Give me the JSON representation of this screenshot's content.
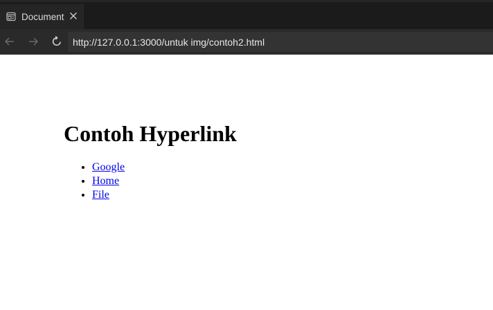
{
  "tab": {
    "title": "Document",
    "icon": "page-icon",
    "close_icon": "close-icon"
  },
  "navigation": {
    "back_icon": "arrow-left-icon",
    "forward_icon": "arrow-right-icon",
    "reload_icon": "reload-icon",
    "url": "http://127.0.0.1:3000/untuk img/contoh2.html"
  },
  "page": {
    "heading": "Contoh Hyperlink",
    "links": [
      {
        "label": "Google"
      },
      {
        "label": "Home"
      },
      {
        "label": "File"
      }
    ]
  },
  "colors": {
    "tab_bar": "#1b1b1b",
    "tab_active": "#252525",
    "nav_bar": "#2a2a2a",
    "address_bg": "#333333",
    "link": "#0000ee"
  }
}
